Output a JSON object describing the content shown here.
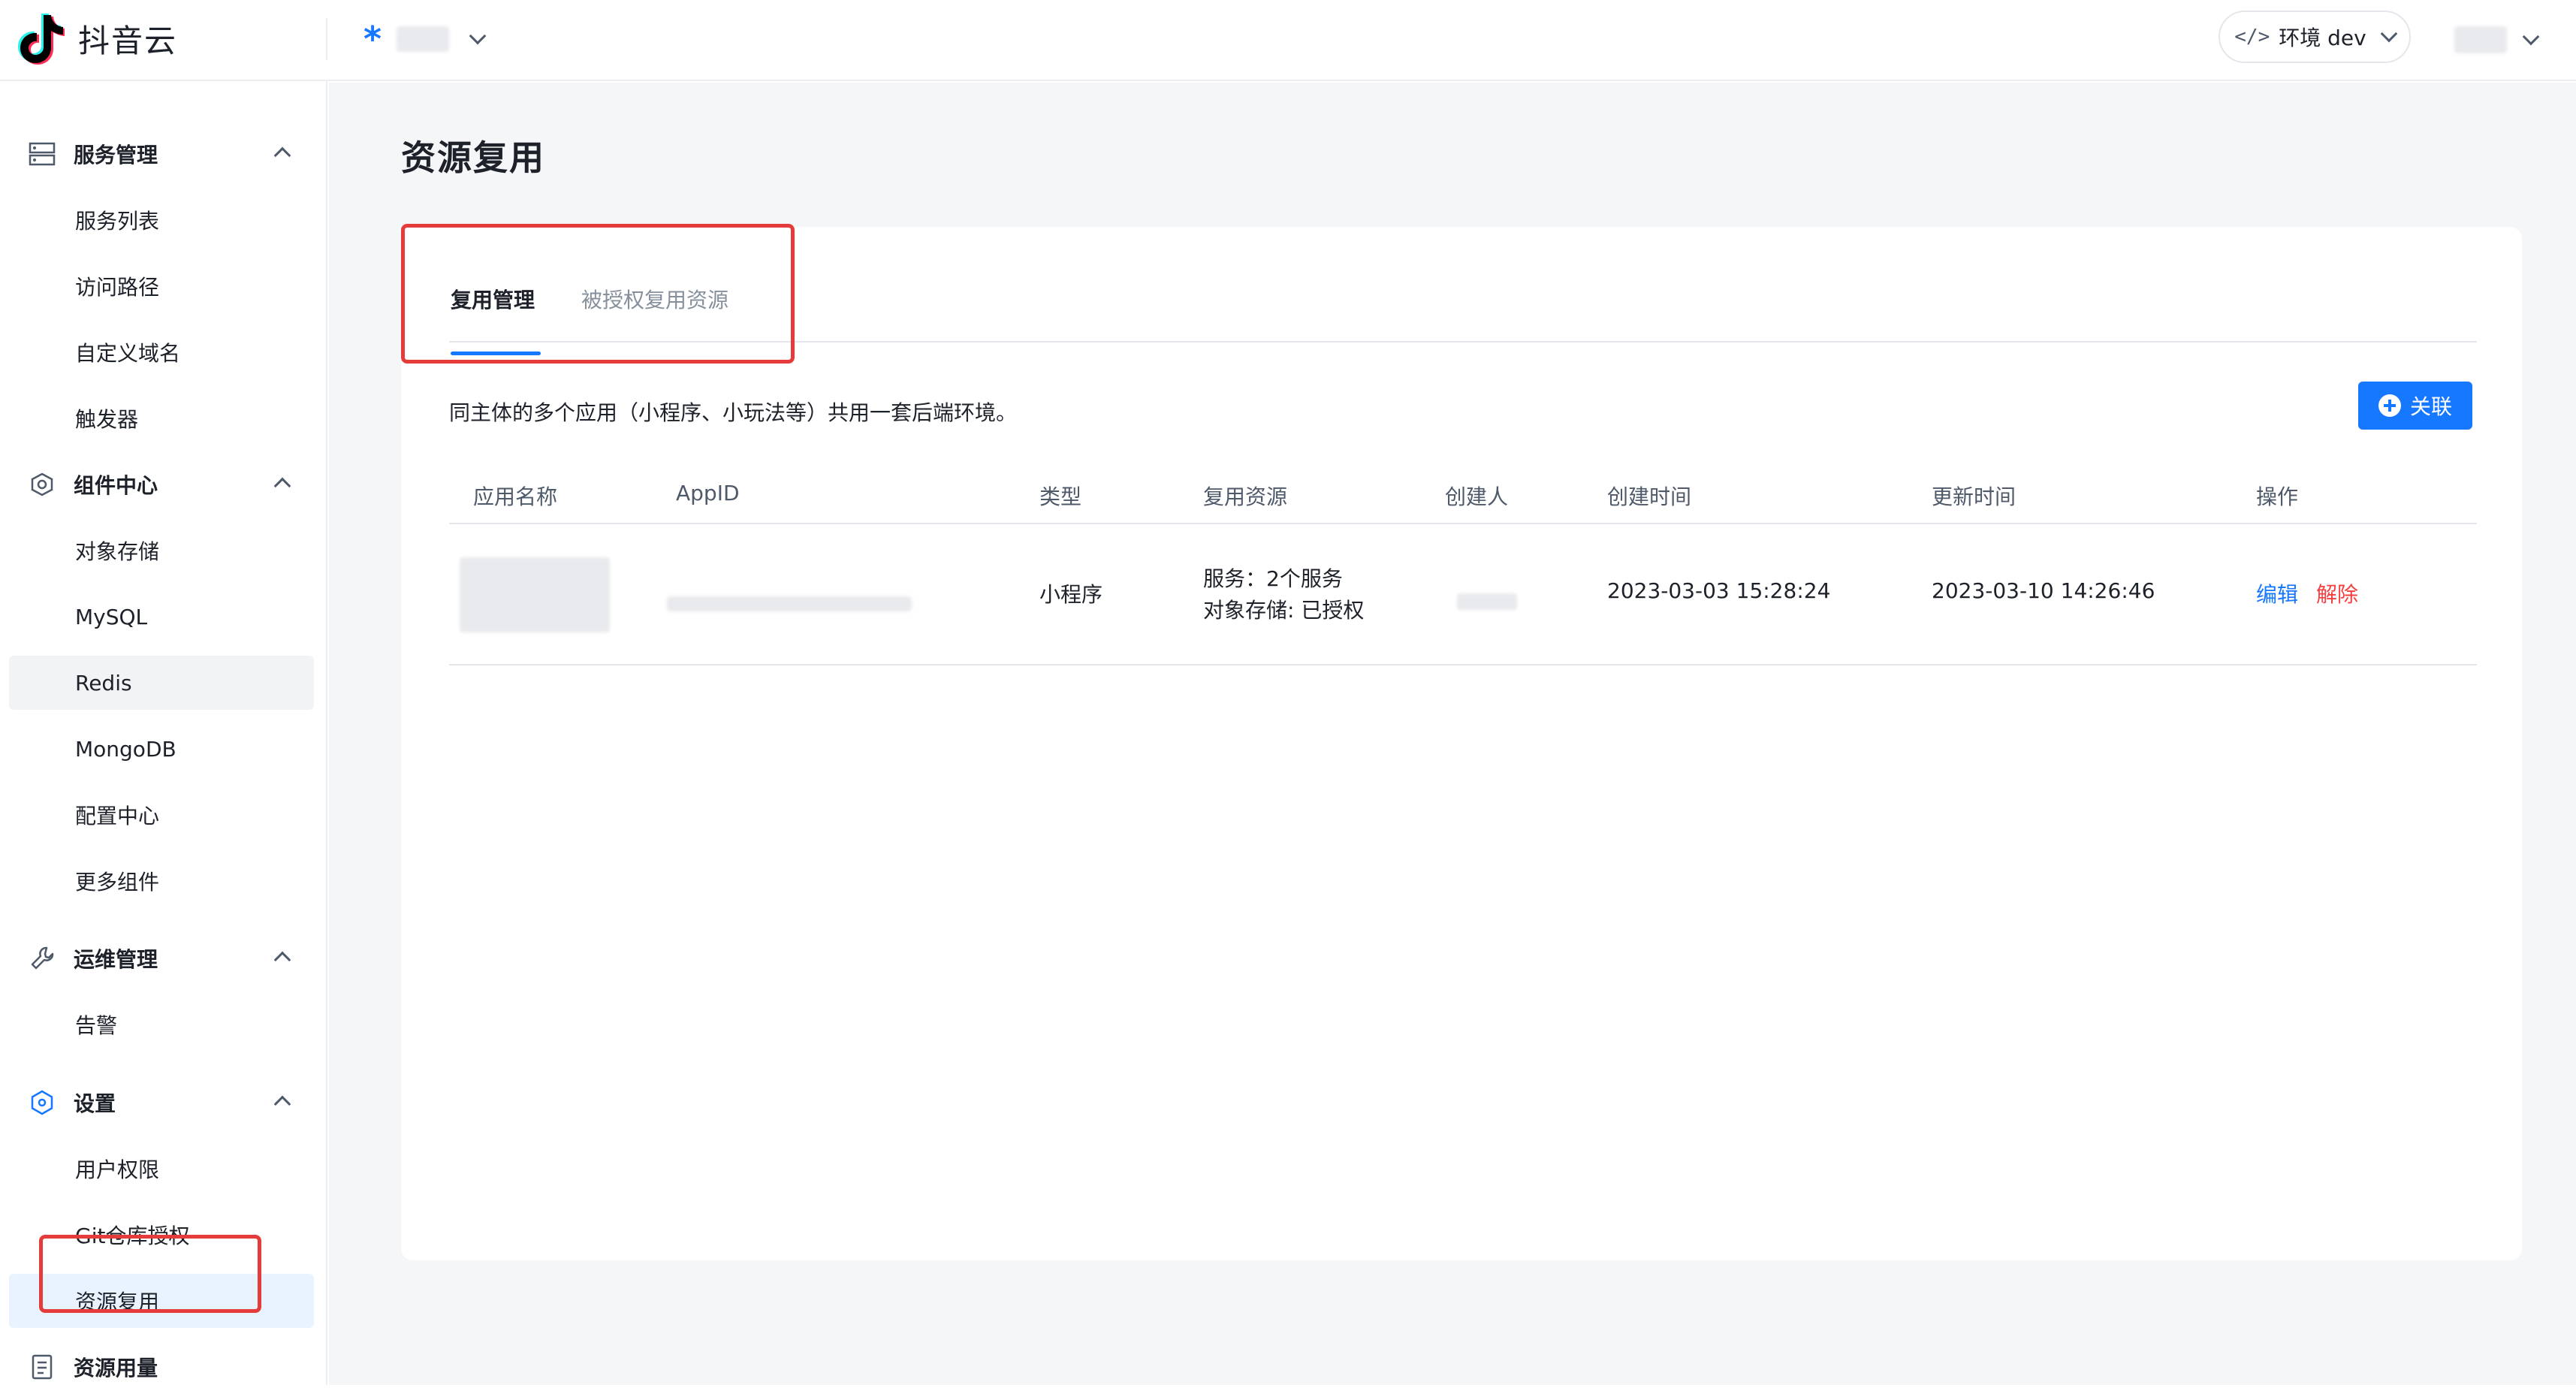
{
  "header": {
    "brand": "抖音云",
    "env_label": "环境 dev"
  },
  "sidebar": {
    "groups": [
      {
        "label": "服务管理",
        "icon": "server-icon",
        "items": [
          "服务列表",
          "访问路径",
          "自定义域名",
          "触发器"
        ]
      },
      {
        "label": "组件中心",
        "icon": "component-icon",
        "items": [
          "对象存储",
          "MySQL",
          "Redis",
          "MongoDB",
          "配置中心",
          "更多组件"
        ]
      },
      {
        "label": "运维管理",
        "icon": "wrench-icon",
        "items": [
          "告警"
        ]
      },
      {
        "label": "设置",
        "icon": "settings-icon",
        "items": [
          "用户权限",
          "Git仓库授权",
          "资源复用"
        ]
      },
      {
        "label": "资源用量",
        "icon": "document-icon",
        "items": []
      }
    ]
  },
  "main": {
    "page_title": "资源复用",
    "tabs": [
      {
        "label": "复用管理",
        "active": true
      },
      {
        "label": "被授权复用资源",
        "active": false
      }
    ],
    "description": "同主体的多个应用（小程序、小玩法等）共用一套后端环境。",
    "link_button": "关联",
    "table": {
      "columns": [
        "应用名称",
        "AppID",
        "类型",
        "复用资源",
        "创建人",
        "创建时间",
        "更新时间",
        "操作"
      ],
      "rows": [
        {
          "type": "小程序",
          "resources": [
            "服务：2个服务",
            "对象存储: 已授权"
          ],
          "created_at": "2023-03-03 15:28:24",
          "updated_at": "2023-03-10 14:26:46",
          "actions": [
            "编辑",
            "解除"
          ]
        }
      ]
    }
  },
  "colors": {
    "accent": "#1677ff",
    "danger": "#f53f3f",
    "highlight_box": "#e63b3b"
  }
}
